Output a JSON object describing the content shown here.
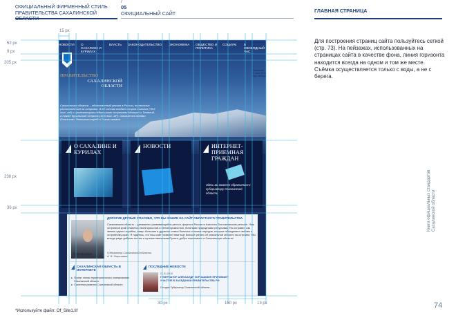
{
  "header": {
    "left_line1": "ОФИЦИАЛЬНЫЙ ФИРМЕННЫЙ СТИЛЬ",
    "left_line2": "ПРАВИТЕЛЬСТВА САХАЛИНСКОЙ ОБЛАСТИ",
    "mid_slash": "/",
    "section_number": "05",
    "section_title": "ОФИЦИАЛЬНЫЙ САЙТ",
    "page_title": "ГЛАВНАЯ СТРАНИЦА"
  },
  "dimensions": {
    "top_15": "15 px",
    "left_52": "52 px",
    "left_9": "9 px",
    "left_205": "205 px",
    "left_238": "238 px",
    "left_36": "36 px",
    "bottom_30": "30 px",
    "bottom_150": "150 px",
    "bottom_13": "13 px"
  },
  "site": {
    "nav": [
      "НОВОСТИ",
      "О САХАЛИНЕ И КУРИЛАХ",
      "ВЛАСТЬ",
      "ЗАКОНОДАТЕЛЬСТВО",
      "ЭКОНОМИКА",
      "ОБЩЕСТВО И ПОЛИТИКА",
      "СОЦИУМ",
      "В СВОБОДНЫЙ ЧАС"
    ],
    "gov_title_line1": "ПРАВИТЕЛЬСТВО",
    "gov_title_line2": "САХАЛИНСКОЙ",
    "gov_title_line3": "ОБЛАСТИ",
    "intro": "Сахалинская область – единственный регион в России, полностью расположенный на островах. В ее состав входят остров Сахалин (78,6 тыс. кв²) с прилегающими небольшими островами Монерон и Тюлений, а также Курильские острова (15,6 тыс. кв²). Омывается водами Охотского, Японского морей и Тихого океана.",
    "photo_caption": "Океанское 21 мая 2010 года четверг",
    "tiles": [
      {
        "label": "О САХАЛИНЕ И КУРИЛАХ"
      },
      {
        "label": "НОВОСТИ"
      },
      {
        "label": "ИНТЕРНЕТ-ПРИЕМНАЯ ГРАЖДАН",
        "text": "Здесь вы можете обратиться к губернатору Сахалинской области"
      }
    ],
    "greeting": "ДОРОГИЕ ДРУЗЬЯ! СПАСИБО, ЧТО ВЫ ЗАШЛИ НА САЙТ ОБЛАСТНОГО ПРАВИТЕЛЬСТВА.",
    "greeting_text": "Сахалинская область – динамично развивающийся регион, форпост России в Азиатско-Тихоокеанском регионе. Наш островной край славится своей красотой и неповторимостью, богатыми природными ресурсами. На островах, как звенья одного корабля, живут большие и дружные семьи больших и малых народов, которые объединяет любовь к островному краю. Я надеюсь, что наш сайт позволит вам еще больше узнать об уникальной области на островах. Мы всегда рады добрым гостям и путешественникам Ручьта, добро пожаловать в Сахалинскую область!",
    "signature": "Хорошавин",
    "gov_signature_line1": "Губернатор Сахалинской области",
    "gov_signature_line2": "А. В. Хорошавин",
    "col_left_title": "САХАЛИНСКАЯ ОБЛАСТЬ В ИНТЕРНЕТЕ",
    "col_left_items": [
      "Проект схемы территориального планирования Сахалинской области",
      "Стратегия развития Сахалинской области"
    ],
    "col_right_title": "ПОСЛЕДНИЕ НОВОСТИ",
    "news_date": "21.01.2010",
    "news_title": "ГУБЕРНАТОР АЛЕКСАНДР ХОРОШАВИН ПРИНИМАЕТ УЧАСТИЕ В ЗАСЕДАНИИ ПРАВИТЕЛЬСТВА РФ",
    "news_text": "Сегодня Губернатор Сахалинской области..."
  },
  "right_text": "Для построения страниц сайта пользуйтесь сеткой (стр. 73). На пейзажах, использованных на страницах сайта в качестве фона, линия горизонта находится всегда на одном и том же месте. Съёмка осуществляется только с воды, а не с берега.",
  "side_caption": "Книга официальных стандартов Сахалинской области",
  "page_number": "74",
  "footnote": "*Используйте файл: Of_Site1.tif",
  "colors": {
    "brand_navy": "#1f3f73",
    "grid_line": "#3ab8e8",
    "site_bg": "#17285a",
    "tile_accent": "#1e8fe0"
  }
}
